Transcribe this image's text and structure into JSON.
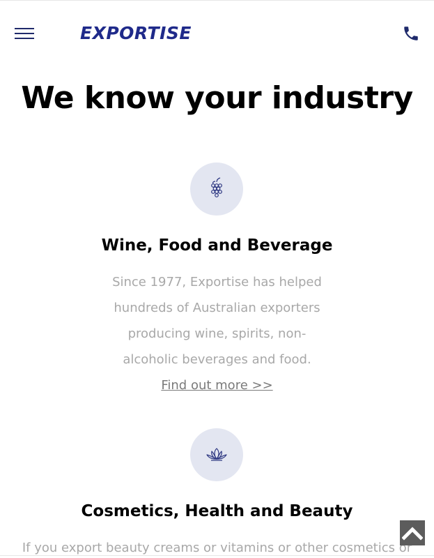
{
  "header": {
    "logo_text": "EXPORTISE",
    "menu_icon": "hamburger-menu-icon",
    "phone_icon": "phone-icon",
    "brand_color": "#1f2a8a"
  },
  "main": {
    "title": "We know your industry",
    "industries": [
      {
        "icon": "grapes-icon",
        "title": "Wine, Food and Beverage",
        "description_lines": [
          "Since 1977, Exportise has helped",
          "hundreds of Australian exporters",
          "producing wine, spirits, non-",
          "alcoholic beverages and food."
        ],
        "link": "Find out more >>"
      },
      {
        "icon": "lotus-icon",
        "title": "Cosmetics, Health and Beauty",
        "description_partial": "If you export beauty creams or vitamins or other cosmetics or"
      }
    ]
  },
  "scroll_top_icon": "chevron-up-icon",
  "colors": {
    "icon_circle": "#e3e6f1",
    "muted_text": "#a8a8a8",
    "scroll_button": "#5c5c5c"
  }
}
